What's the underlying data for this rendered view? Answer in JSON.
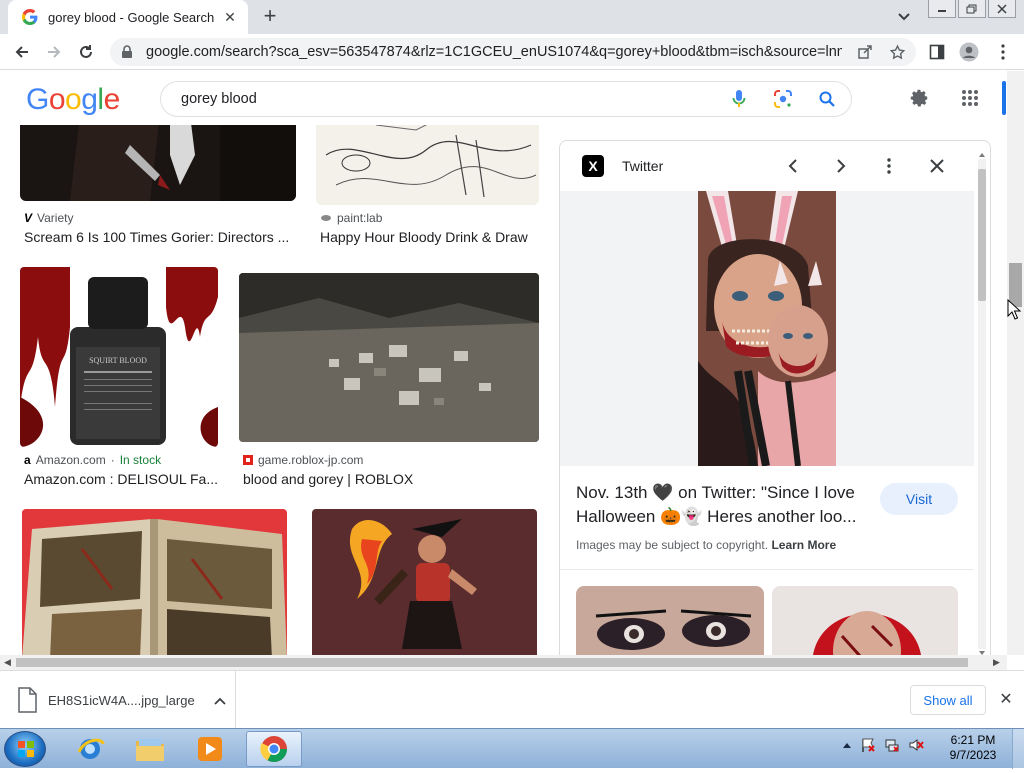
{
  "browser": {
    "tab_title": "gorey blood - Google Search",
    "tab_close": "✕",
    "new_tab": "+",
    "url": "google.com/search?sca_esv=563547874&rlz=1C1GCEU_enUS1074&q=gorey+blood&tbm=isch&source=lnms&..."
  },
  "google": {
    "logo_letters": [
      "G",
      "o",
      "o",
      "g",
      "l",
      "e"
    ],
    "logo_colors": [
      "#4285f4",
      "#ea4335",
      "#fbbc05",
      "#4285f4",
      "#34a853",
      "#ea4335"
    ],
    "query": "gorey blood"
  },
  "results": [
    {
      "source": "Variety",
      "caption": "Scream 6 Is 100 Times Gorier: Directors ..."
    },
    {
      "source": "paint:lab",
      "caption": "Happy Hour Bloody Drink & Draw"
    },
    {
      "source": "Amazon.com",
      "stock": "In stock",
      "caption": "Amazon.com : DELISOUL Fa..."
    },
    {
      "source": "game.roblox-jp.com",
      "caption": "blood and gorey | ROBLOX"
    }
  ],
  "panel": {
    "site": "Twitter",
    "logo_letter": "X",
    "title": "Nov. 13th 🖤 on Twitter: \"Since I love Halloween 🎃👻 Heres another loo...",
    "visit": "Visit",
    "copyright": "Images may be subject to copyright.",
    "learn_more": "Learn More"
  },
  "download": {
    "filename": "EH8S1icW4A....jpg_large",
    "show_all": "Show all",
    "close": "✕"
  },
  "taskbar": {
    "time": "6:21 PM",
    "date": "9/7/2023"
  }
}
